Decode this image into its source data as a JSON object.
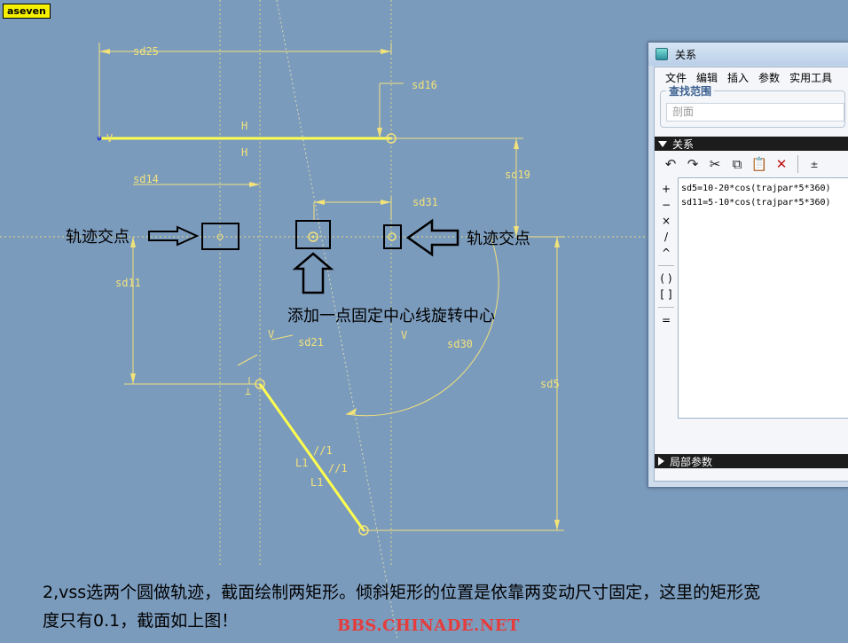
{
  "tag": "aseven",
  "sketch": {
    "dims": [
      "sd25",
      "sd16",
      "sd19",
      "sd14",
      "sd31",
      "sd11",
      "sd21",
      "sd30",
      "sd5"
    ],
    "constraint_h": "H",
    "constraint_v": "V",
    "constraint_perp": "⊥",
    "constraint_parallel": "//1",
    "constraint_len": "L1"
  },
  "annotations": {
    "left_label": "轨迹交点",
    "right_label": "轨迹交点",
    "center_label": "添加一点固定中心线旋转中心"
  },
  "caption": {
    "line1": "2,vss选两个圆做轨迹，截面绘制两矩形。倾斜矩形的位置是依靠两变动尺寸固定，这里的矩形宽",
    "line2": "度只有0.1，截面如上图！"
  },
  "watermark": "BBS.CHINADE.NET",
  "dialog": {
    "title": "关系",
    "menu": [
      "文件",
      "编辑",
      "插入",
      "参数",
      "实用工具"
    ],
    "scope_legend": "查找范围",
    "scope_value": "剖面",
    "relations_header": "关系",
    "operators": [
      "+",
      "−",
      "×",
      "/",
      "^",
      "( )",
      "[ ]",
      "="
    ],
    "relations": [
      "sd5=10-20*cos(trajpar*5*360)",
      "sd11=5-10*cos(trajpar*5*360)"
    ],
    "local_params_header": "局部参数"
  }
}
